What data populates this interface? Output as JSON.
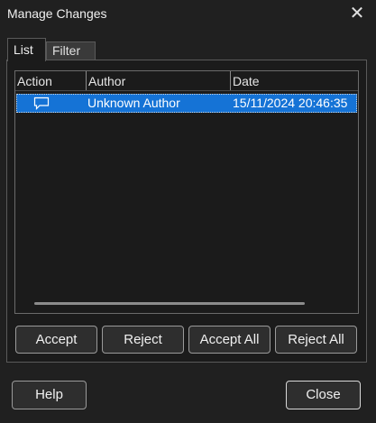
{
  "window": {
    "title": "Manage Changes",
    "close_glyph": "✕"
  },
  "tabs": [
    {
      "label": "List",
      "selected": true
    },
    {
      "label": "Filter",
      "selected": false
    }
  ],
  "list": {
    "columns": [
      "Action",
      "Author",
      "Date"
    ],
    "rows": [
      {
        "action_icon": "comment-icon",
        "author": "Unknown Author",
        "date": "15/11/2024 20:46:35",
        "selected": true
      }
    ]
  },
  "buttons": {
    "accept": "Accept",
    "reject": "Reject",
    "accept_all": "Accept All",
    "reject_all": "Reject All",
    "help": "Help",
    "close": "Close"
  },
  "colors": {
    "background": "#202020",
    "selection": "#1573d6"
  }
}
